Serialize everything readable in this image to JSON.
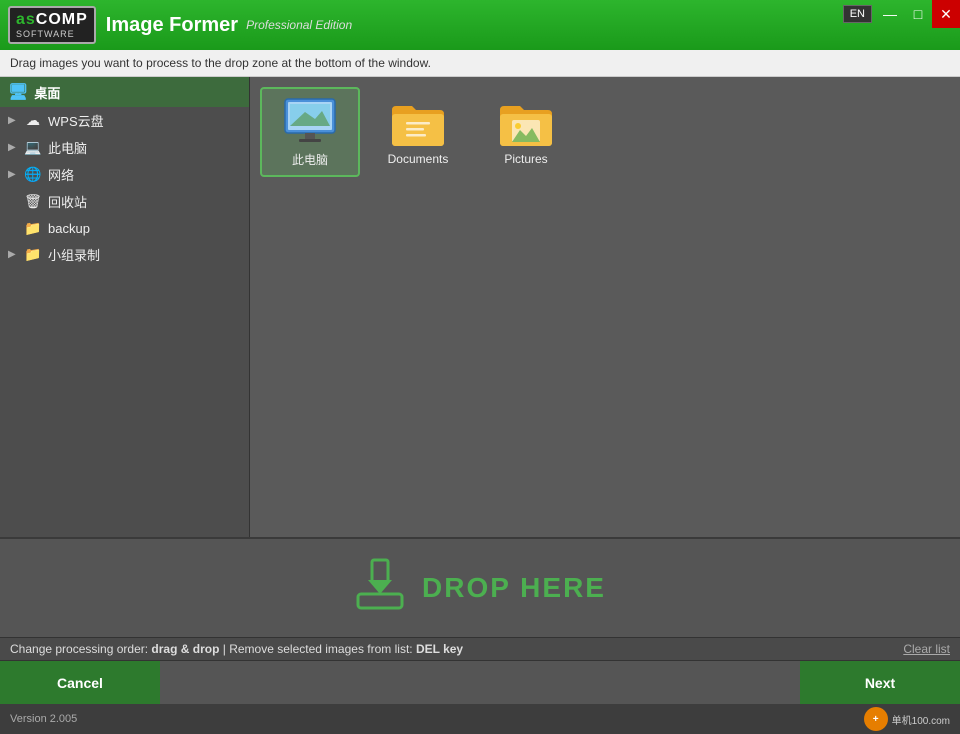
{
  "titlebar": {
    "logo": "ascomp",
    "logo_sub": "SOFTWARE",
    "app_title": "Image Former",
    "edition": "Professional Edition",
    "lang": "EN"
  },
  "window_controls": {
    "minimize": "—",
    "maximize": "□",
    "close": "✕"
  },
  "info_bar": {
    "text": "Drag images you want to process to the drop zone at the bottom of the window."
  },
  "tree": {
    "header_label": "桌面",
    "items": [
      {
        "label": "WPS云盘",
        "has_arrow": true,
        "icon": "cloud"
      },
      {
        "label": "此电脑",
        "has_arrow": true,
        "icon": "pc"
      },
      {
        "label": "网络",
        "has_arrow": true,
        "icon": "network"
      },
      {
        "label": "回收站",
        "has_arrow": false,
        "icon": "trash"
      },
      {
        "label": "backup",
        "has_arrow": false,
        "icon": "folder"
      },
      {
        "label": "小组录制",
        "has_arrow": true,
        "icon": "folder"
      }
    ]
  },
  "files": [
    {
      "label": "此电脑",
      "type": "pc",
      "selected": true
    },
    {
      "label": "Documents",
      "type": "folder_gold"
    },
    {
      "label": "Pictures",
      "type": "folder_image"
    }
  ],
  "drop_zone": {
    "text": "DROP HERE"
  },
  "status_bar": {
    "change_order_text": "Change processing order:",
    "drag_drop": "drag & drop",
    "remove_text": "Remove selected images from list:",
    "del_key": "DEL key",
    "clear_list": "Clear list"
  },
  "buttons": {
    "cancel": "Cancel",
    "next": "Next"
  },
  "version": {
    "text": "Version 2.005"
  },
  "watermark": {
    "icon": "+",
    "site": "单机100.com"
  }
}
